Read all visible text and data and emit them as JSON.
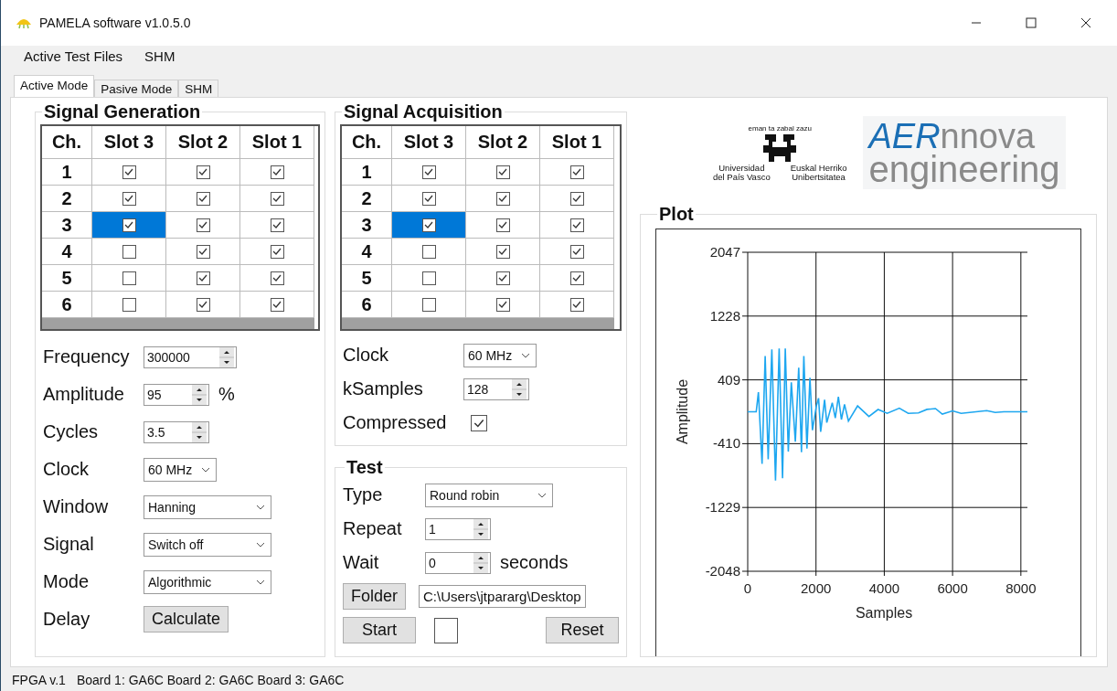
{
  "window": {
    "title": "PAMELA software v1.0.5.0"
  },
  "menu": [
    "Active Test Files",
    "SHM"
  ],
  "tabs": [
    {
      "label": "Active Mode",
      "selected": true
    },
    {
      "label": "Pasive Mode",
      "selected": false
    },
    {
      "label": "SHM",
      "selected": false
    }
  ],
  "signal_generation": {
    "title": "Signal Generation",
    "table": {
      "columns": [
        "Ch.",
        "Slot 3",
        "Slot 2",
        "Slot 1"
      ],
      "rows": [
        {
          "ch": "1",
          "slots": [
            {
              "checked": true,
              "selected": false
            },
            {
              "checked": true,
              "selected": false
            },
            {
              "checked": true,
              "selected": false
            }
          ]
        },
        {
          "ch": "2",
          "slots": [
            {
              "checked": true,
              "selected": false
            },
            {
              "checked": true,
              "selected": false
            },
            {
              "checked": true,
              "selected": false
            }
          ]
        },
        {
          "ch": "3",
          "slots": [
            {
              "checked": true,
              "selected": true
            },
            {
              "checked": true,
              "selected": false
            },
            {
              "checked": true,
              "selected": false
            }
          ]
        },
        {
          "ch": "4",
          "slots": [
            {
              "checked": false,
              "selected": false
            },
            {
              "checked": true,
              "selected": false
            },
            {
              "checked": true,
              "selected": false
            }
          ]
        },
        {
          "ch": "5",
          "slots": [
            {
              "checked": false,
              "selected": false
            },
            {
              "checked": true,
              "selected": false
            },
            {
              "checked": true,
              "selected": false
            }
          ]
        },
        {
          "ch": "6",
          "slots": [
            {
              "checked": false,
              "selected": false
            },
            {
              "checked": true,
              "selected": false
            },
            {
              "checked": true,
              "selected": false
            }
          ]
        }
      ]
    },
    "fields": [
      {
        "kind": "spin",
        "label": "Frequency",
        "value": "300000"
      },
      {
        "kind": "spin",
        "label": "Amplitude",
        "value": "95",
        "unit": "%"
      },
      {
        "kind": "spin",
        "label": "Cycles",
        "value": "3.5"
      },
      {
        "kind": "combo",
        "label": "Clock",
        "value": "60 MHz"
      },
      {
        "kind": "combo",
        "label": "Window",
        "value": "Hanning"
      },
      {
        "kind": "combo",
        "label": "Signal",
        "value": "Switch off"
      },
      {
        "kind": "combo",
        "label": "Mode",
        "value": "Algorithmic"
      },
      {
        "kind": "button",
        "label": "Delay",
        "value": "Calculate"
      }
    ]
  },
  "signal_acquisition": {
    "title": "Signal Acquisition",
    "table": {
      "columns": [
        "Ch.",
        "Slot 3",
        "Slot 2",
        "Slot 1"
      ],
      "rows": [
        {
          "ch": "1",
          "slots": [
            {
              "checked": true,
              "selected": false
            },
            {
              "checked": true,
              "selected": false
            },
            {
              "checked": true,
              "selected": false
            }
          ]
        },
        {
          "ch": "2",
          "slots": [
            {
              "checked": true,
              "selected": false
            },
            {
              "checked": true,
              "selected": false
            },
            {
              "checked": true,
              "selected": false
            }
          ]
        },
        {
          "ch": "3",
          "slots": [
            {
              "checked": true,
              "selected": true
            },
            {
              "checked": true,
              "selected": false
            },
            {
              "checked": true,
              "selected": false
            }
          ]
        },
        {
          "ch": "4",
          "slots": [
            {
              "checked": false,
              "selected": false
            },
            {
              "checked": true,
              "selected": false
            },
            {
              "checked": true,
              "selected": false
            }
          ]
        },
        {
          "ch": "5",
          "slots": [
            {
              "checked": false,
              "selected": false
            },
            {
              "checked": true,
              "selected": false
            },
            {
              "checked": true,
              "selected": false
            }
          ]
        },
        {
          "ch": "6",
          "slots": [
            {
              "checked": false,
              "selected": false
            },
            {
              "checked": true,
              "selected": false
            },
            {
              "checked": true,
              "selected": false
            }
          ]
        }
      ]
    },
    "fields": [
      {
        "kind": "combo",
        "label": "Clock",
        "value": "60 MHz"
      },
      {
        "kind": "spin",
        "label": "kSamples",
        "value": "128"
      },
      {
        "kind": "check",
        "label": "Compressed",
        "checked": true
      }
    ]
  },
  "test": {
    "title": "Test",
    "fields": [
      {
        "kind": "combo",
        "label": "Type",
        "value": "Round robin"
      },
      {
        "kind": "spin",
        "label": "Repeat",
        "value": "1"
      },
      {
        "kind": "spin",
        "label": "Wait",
        "value": "0",
        "unit": "seconds"
      }
    ],
    "folder_button": "Folder",
    "path": "C:\\Users\\jtpararg\\Desktop",
    "start_button": "Start",
    "indicator": {
      "checked": false
    },
    "reset_button": "Reset"
  },
  "logos": {
    "university": {
      "motto": "eman ta zabal zazu",
      "name_es": [
        "Universidad",
        "del País Vasco"
      ],
      "name_eu": [
        "Euskal Herriko",
        "Unibertsitatea"
      ]
    },
    "company": {
      "bold_part": "AER",
      "rest": "nnova",
      "tagline": "engineering"
    }
  },
  "plot": {
    "title": "Plot",
    "chart_data": {
      "type": "line",
      "grid": true,
      "xlabel": "Samples",
      "ylabel": "Amplitude",
      "xlim": [
        0,
        8192
      ],
      "ylim": [
        -2048,
        2047
      ],
      "xticks": [
        0,
        2000,
        4000,
        6000,
        8000
      ],
      "yticks": [
        2047,
        1228,
        409,
        -410,
        -1229,
        -2048
      ],
      "x": [
        0,
        250,
        313,
        420,
        510,
        600,
        706,
        813,
        921,
        1019,
        1100,
        1189,
        1278,
        1394,
        1493,
        1573,
        1645,
        1734,
        1824,
        1895,
        2011,
        2074,
        2136,
        2252,
        2315,
        2476,
        2565,
        2655,
        2744,
        2834,
        2950,
        3218,
        3549,
        3817,
        4085,
        4442,
        4700,
        5000,
        5250,
        5500,
        5700,
        6000,
        6250,
        6500,
        7000,
        7250,
        7500,
        8192
      ],
      "series": [
        {
          "color": "#1ea7f0",
          "values": [
            0,
            0,
            252,
            -669,
            715,
            -610,
            801,
            -884,
            813,
            -853,
            813,
            -512,
            378,
            -383,
            566,
            -520,
            715,
            -473,
            437,
            -238,
            75,
            174,
            -257,
            154,
            -140,
            115,
            -82,
            193,
            -100,
            94,
            -120,
            75,
            -61,
            29,
            -20,
            45,
            -20,
            -15,
            30,
            40,
            -30,
            10,
            -20,
            -10,
            15,
            -10,
            0,
            0
          ]
        }
      ]
    }
  },
  "status_bar": [
    "FPGA v.1",
    "Board 1: GA6C Board 2: GA6C Board 3: GA6C"
  ]
}
